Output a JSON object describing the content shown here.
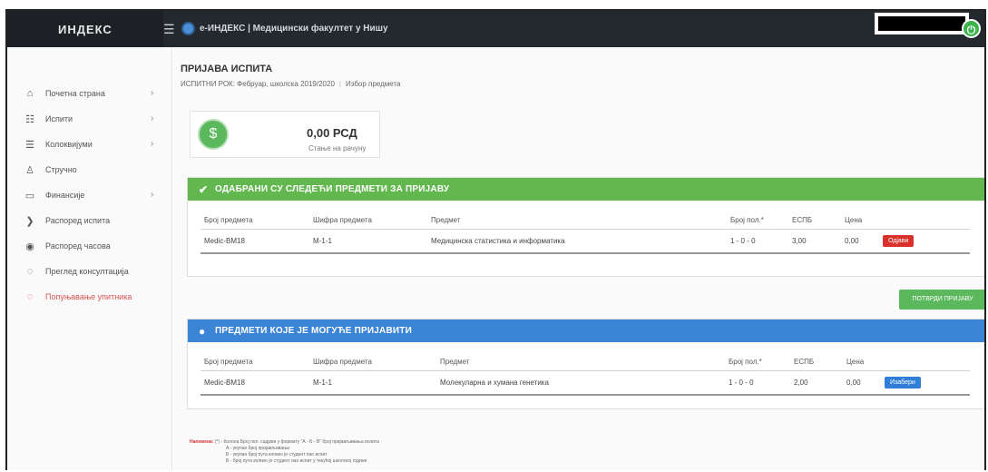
{
  "topbar": {
    "brand": "ИНДЕКС",
    "menu_icon": "hamburger-icon",
    "logo_icon": "university-logo-icon",
    "app_title": "e-ИНДЕКС | Медицински факултет у Нишу",
    "avatar_initial": "⓪"
  },
  "sidebar": {
    "items": [
      {
        "icon": "⌂",
        "label": "Почетна страна",
        "chev": "›"
      },
      {
        "icon": "☷",
        "label": "Испити",
        "chev": "›"
      },
      {
        "icon": "☰",
        "label": "Колоквијуми",
        "chev": "›"
      },
      {
        "icon": "♙",
        "label": "Стручно",
        "chev": ""
      },
      {
        "icon": "▭",
        "label": "Финансије",
        "chev": "›"
      },
      {
        "icon": "❯",
        "label": "Распоред испита",
        "chev": ""
      },
      {
        "icon": "◉",
        "label": "Распоред часова",
        "chev": ""
      },
      {
        "icon": "◌",
        "label": "Преглед консултација",
        "chev": ""
      },
      {
        "icon": "◌",
        "label": "Попуњавање упитника",
        "chev": ""
      }
    ]
  },
  "main": {
    "title": "ПРИЈАВА ИСПИТА",
    "breadcrumb": [
      "ИСПИТНИ РОК: Фебруар, школска 2019/2020",
      "Избор предмета"
    ],
    "price": {
      "amount": "0,00 РСД",
      "label": "Стање на рачуну",
      "icon": "$"
    },
    "panel1": {
      "title": "ОДАБРАНИ СУ СЛЕДЕЋИ ПРЕДМЕТИ ЗА ПРИЈАВУ",
      "icon": "✔",
      "columns": [
        "Број предмета",
        "Шифра предмета",
        "Предмет",
        "Број пол.*",
        "ЕСПБ",
        "Цена",
        ""
      ],
      "rows": [
        {
          "num": "Medic-BM18",
          "code": "M-1-1",
          "name": "Медицинска статистика и информатика",
          "pol": "1 - 0 - 0",
          "espb": "3,00",
          "price": "0,00",
          "action": "Одјави"
        }
      ]
    },
    "submit_button": "ПОТВРДИ ПРИЈАВУ",
    "panel2": {
      "title": "ПРЕДМЕТИ КОЈЕ ЈЕ МОГУЋЕ ПРИЈАВИТИ",
      "icon": "●",
      "columns": [
        "Број предмета",
        "Шифра предмета",
        "Предмет",
        "Број пол.*",
        "ЕСПБ",
        "Цена",
        ""
      ],
      "rows": [
        {
          "num": "Medic-BM18",
          "code": "M-1-1",
          "name": "Молекуларна и хумана генетика",
          "pol": "1 - 0 - 0",
          "espb": "2,00",
          "price": "0,00",
          "action": "Изабери"
        }
      ]
    },
    "legend": {
      "key": "Напомена:",
      "lines": [
        "(*) - Колона Број пол. садржи у формату \"А - Б - В\" број пријављивања испита",
        "А - укупан број пријављивања",
        "Б - укупан број пута колико је студент пао испит",
        "В - број пута колико је студент пао испит у текућој школској години"
      ]
    }
  }
}
